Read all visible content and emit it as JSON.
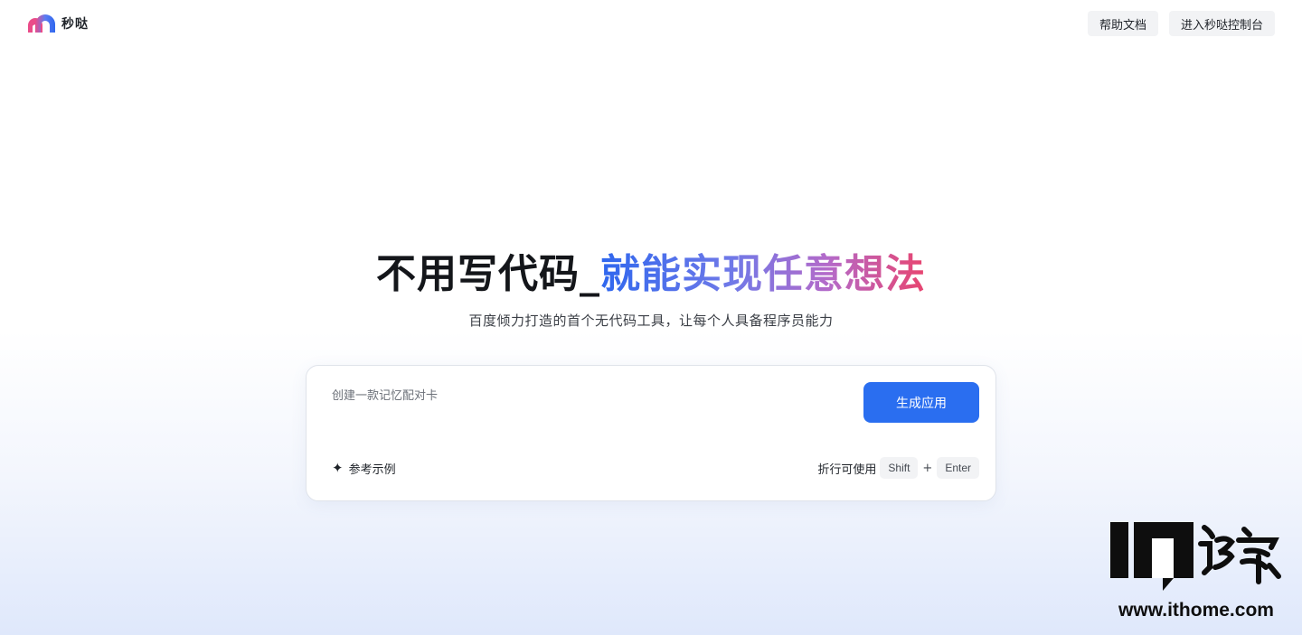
{
  "brand": {
    "name": "秒哒",
    "logo_icon": "miaoda-arch-logo-icon"
  },
  "header": {
    "help_docs_label": "帮助文档",
    "console_label": "进入秒哒控制台"
  },
  "hero": {
    "title_dark": "不用写代码_",
    "title_gradient": "就能实现任意想法",
    "subtitle": "百度倾力打造的首个无代码工具，让每个人具备程序员能力"
  },
  "prompt": {
    "placeholder": "创建一款记忆配对卡",
    "generate_label": "生成应用",
    "examples_label": "参考示例",
    "examples_icon": "sparkle-icon",
    "hint_label": "折行可使用",
    "key_shift": "Shift",
    "key_plus": "+",
    "key_enter": "Enter"
  },
  "watermark": {
    "url": "www.ithome.com"
  },
  "colors": {
    "accent": "#2a6ef0",
    "gradient_start": "#2f67ee",
    "gradient_end": "#e8446f"
  }
}
